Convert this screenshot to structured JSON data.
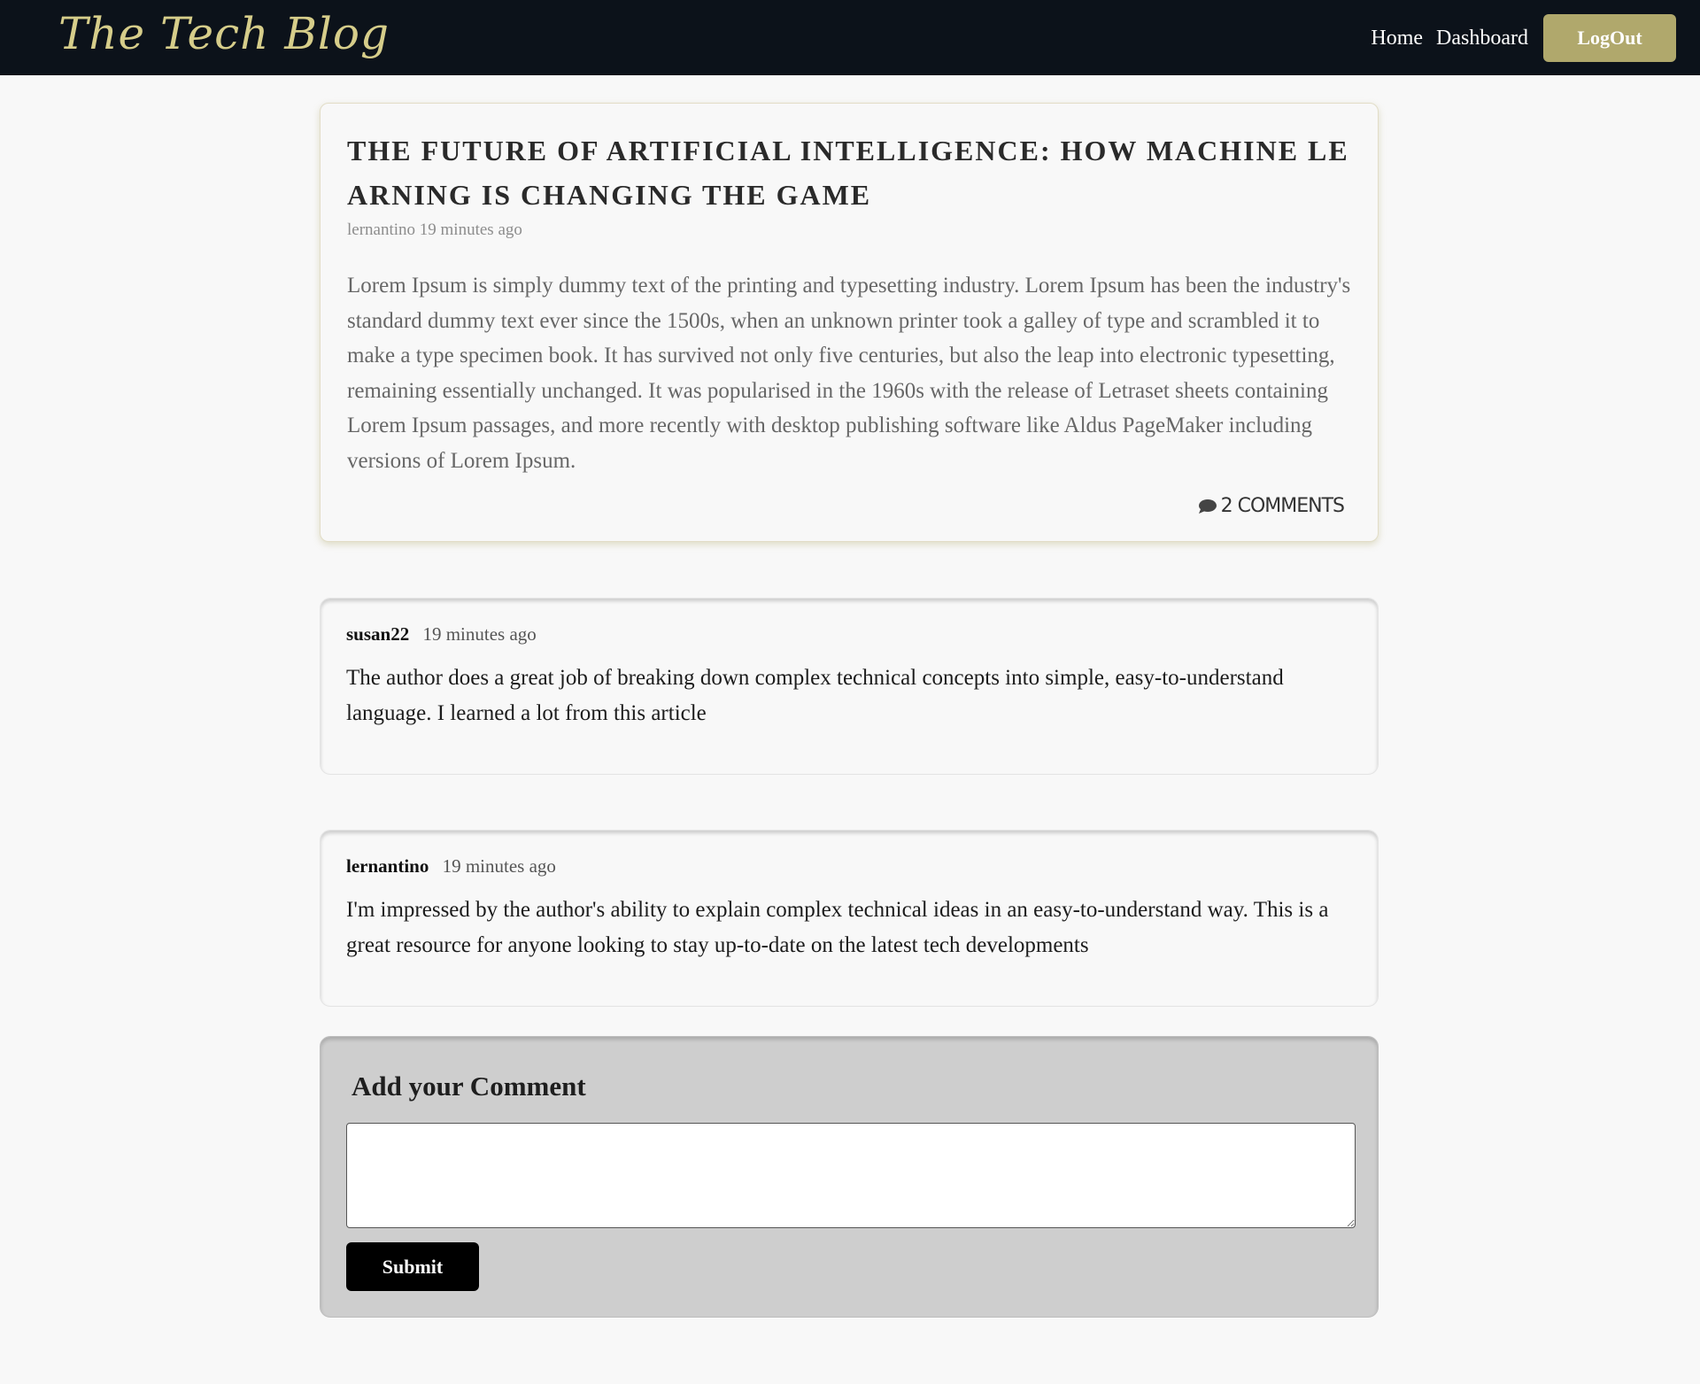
{
  "header": {
    "brand": "The Tech Blog",
    "nav": {
      "home": "Home",
      "dashboard": "Dashboard",
      "logout": "LogOut"
    }
  },
  "post": {
    "title": "THE FUTURE OF ARTIFICIAL INTELLIGENCE: HOW MACHINE LEARNING IS CHANGING THE GAME",
    "author": "lernantino",
    "time": "19 minutes ago",
    "body": "Lorem Ipsum is simply dummy text of the printing and typesetting industry. Lorem Ipsum has been the industry's standard dummy text ever since the 1500s, when an unknown printer took a galley of type and scrambled it to make a type specimen book. It has survived not only five centuries, but also the leap into electronic typesetting, remaining essentially unchanged. It was popularised in the 1960s with the release of Letraset sheets containing Lorem Ipsum passages, and more recently with desktop publishing software like Aldus PageMaker including versions of Lorem Ipsum.",
    "comment_count": "2 COMMENTS",
    "comment_icon": "comment-bubble-icon"
  },
  "comments": [
    {
      "user": "susan22",
      "time": "19 minutes ago",
      "text": "The author does a great job of breaking down complex technical concepts into simple, easy-to-understand language. I learned a lot from this article"
    },
    {
      "user": "lernantino",
      "time": "19 minutes ago",
      "text": "I'm impressed by the author's ability to explain complex technical ideas in an easy-to-understand way. This is a great resource for anyone looking to stay up-to-date on the latest tech developments"
    }
  ],
  "add_comment": {
    "title": "Add your Comment",
    "textarea_value": "",
    "submit_label": "Submit"
  },
  "colors": {
    "navbar": "#0c121a",
    "brand": "#d6cd8a",
    "accent": "#b0a86c",
    "page_bg": "#f8f8f8",
    "form_bg": "#cecece"
  }
}
